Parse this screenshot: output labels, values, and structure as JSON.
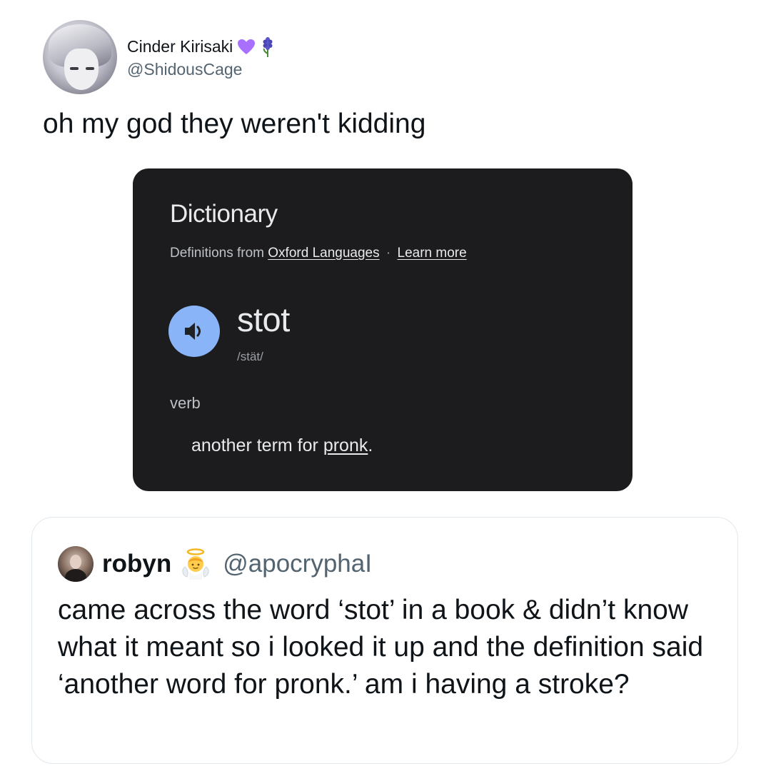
{
  "tweet": {
    "author_name": "Cinder Kirisaki",
    "author_handle": "@ShidousCage",
    "name_emojis": [
      "purple-heart-icon",
      "hyacinth-icon"
    ],
    "text": "oh my god they weren't kidding"
  },
  "dictionary": {
    "title": "Dictionary",
    "source_prefix": "Definitions from",
    "source_link": "Oxford Languages",
    "separator": "·",
    "learn_more": "Learn more",
    "word": "stot",
    "phonetic": "/stät/",
    "part_of_speech": "verb",
    "definition_prefix": "another term for ",
    "definition_link": "pronk",
    "definition_suffix": ".",
    "speaker_icon": "speaker-icon",
    "colors": {
      "card_bg": "#1c1c1e",
      "speaker_bg": "#8ab4f8"
    }
  },
  "quote": {
    "author_name": "robyn",
    "author_handle": "@apocryphaI",
    "name_emoji": "angel-icon",
    "text": "came across the word ‘stot’ in a book & didn’t know what it meant so i looked it up and the definition said ‘another word for pronk.’ am i having a stroke?"
  }
}
